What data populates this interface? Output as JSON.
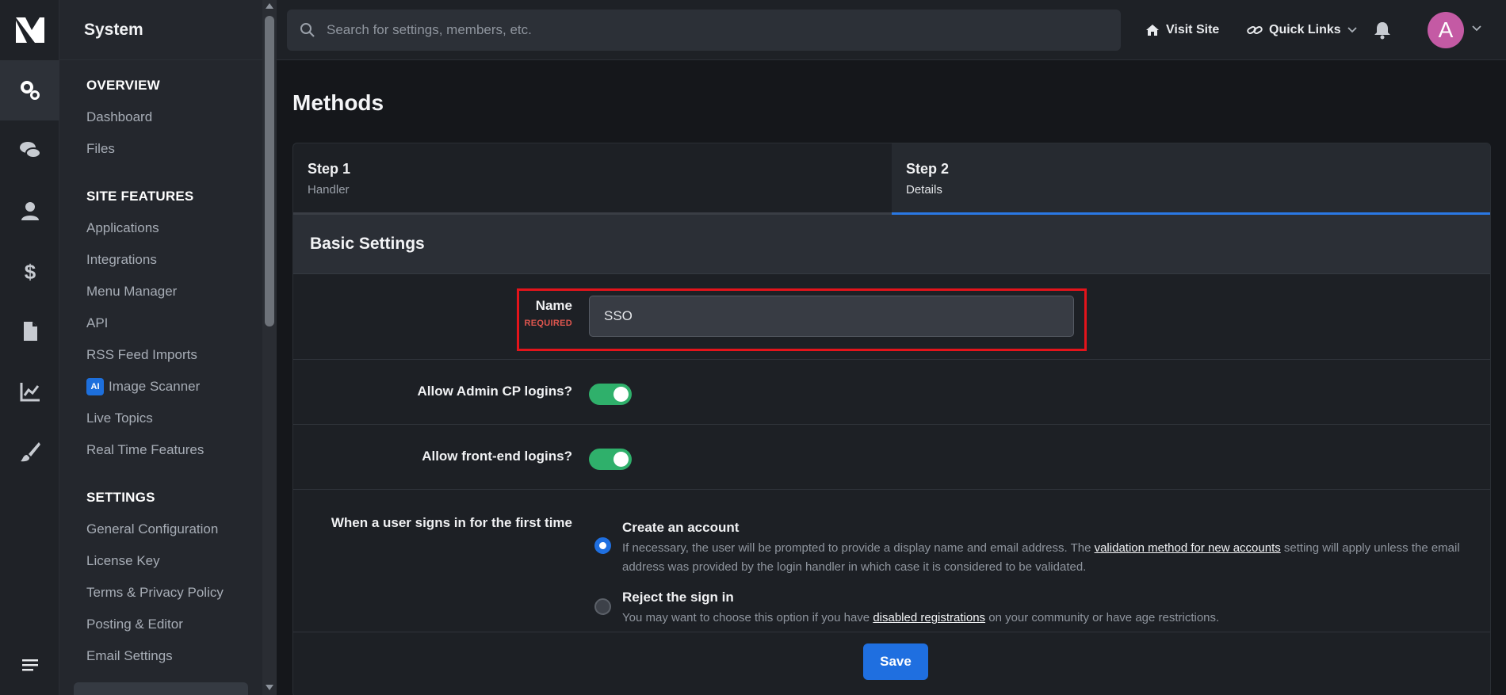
{
  "rail": {
    "icons": [
      "gears-icon",
      "comments-icon",
      "user-icon",
      "dollar-icon",
      "file-icon",
      "chart-line-icon",
      "brush-icon"
    ]
  },
  "sidebar": {
    "title": "System",
    "sections": [
      {
        "heading": "OVERVIEW",
        "items": [
          "Dashboard",
          "Files"
        ]
      },
      {
        "heading": "SITE FEATURES",
        "items": [
          "Applications",
          "Integrations",
          "Menu Manager",
          "API",
          "RSS Feed Imports",
          "Image Scanner",
          "Live Topics",
          "Real Time Features"
        ]
      },
      {
        "heading": "SETTINGS",
        "items": [
          "General Configuration",
          "License Key",
          "Terms & Privacy Policy",
          "Posting & Editor",
          "Email Settings"
        ]
      }
    ],
    "ai_badge": "AI"
  },
  "topbar": {
    "search_placeholder": "Search for settings, members, etc.",
    "visit_site": "Visit Site",
    "quick_links": "Quick Links",
    "avatar_letter": "A"
  },
  "main": {
    "title": "Methods",
    "steps": [
      {
        "title": "Step 1",
        "subtitle": "Handler"
      },
      {
        "title": "Step 2",
        "subtitle": "Details"
      }
    ],
    "section_title": "Basic Settings",
    "name_label": "Name",
    "required_label": "REQUIRED",
    "name_value": "SSO",
    "admin_cp_label": "Allow Admin CP logins?",
    "admin_cp_enabled": true,
    "frontend_label": "Allow front-end logins?",
    "frontend_enabled": true,
    "first_signin_label": "When a user signs in for the first time",
    "options": [
      {
        "title": "Create an account",
        "desc_before": "If necessary, the user will be prompted to provide a display name and email address. The ",
        "link": "validation method for new accounts",
        "desc_after": " setting will apply unless the email address was provided by the login handler in which case it is considered to be validated.",
        "selected": true
      },
      {
        "title": "Reject the sign in",
        "desc_before": "You may want to choose this option if you have ",
        "link": "disabled registrations",
        "desc_after": " on your community or have age restrictions.",
        "selected": false
      }
    ],
    "save_label": "Save"
  },
  "colors": {
    "accent": "#1f6fe0",
    "toggle_on": "#2fb06b",
    "highlight": "#e3141b",
    "required": "#e0564f"
  }
}
